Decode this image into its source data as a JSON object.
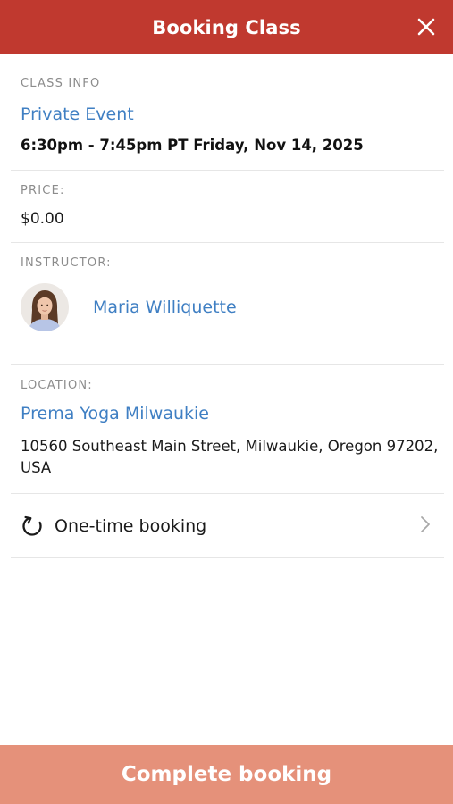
{
  "header": {
    "title": "Booking Class",
    "close_icon": "close-icon",
    "background": "#c0392f"
  },
  "class_info": {
    "label": "CLASS INFO",
    "name": "Private Event",
    "time": "6:30pm - 7:45pm PT Friday, Nov 14, 2025"
  },
  "price": {
    "label": "PRICE:",
    "value": "$0.00"
  },
  "instructor": {
    "label": "INSTRUCTOR:",
    "name": "Maria Williquette",
    "avatar_icon": "instructor-avatar"
  },
  "location": {
    "label": "LOCATION:",
    "name": "Prema Yoga Milwaukie",
    "address": "10560 Southeast Main Street, Milwaukie, Oregon 97202, USA"
  },
  "booking_type": {
    "icon": "refresh-icon",
    "label": "One-time booking",
    "chevron_icon": "chevron-right-icon"
  },
  "footer": {
    "button_label": "Complete booking",
    "button_color": "#e5917a"
  },
  "colors": {
    "accent": "#c0392f",
    "link": "#3f7fc3"
  }
}
